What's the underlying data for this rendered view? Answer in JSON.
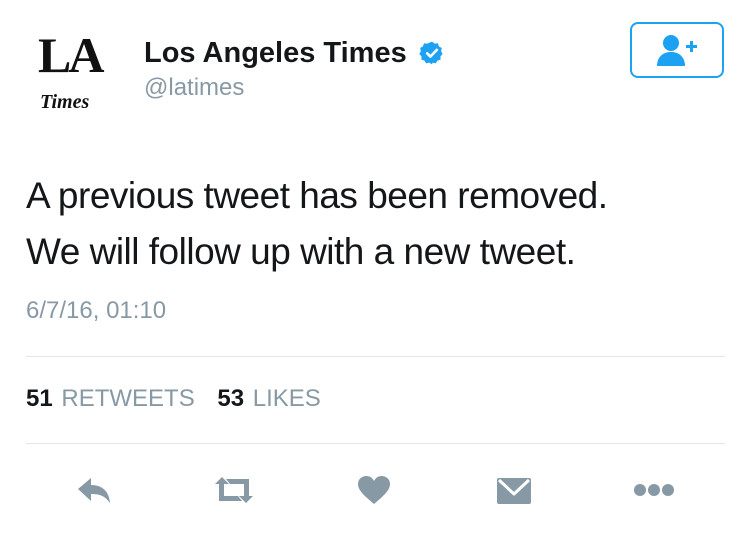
{
  "author": {
    "logo_line1": "LA",
    "logo_line2": "Times",
    "display_name": "Los Angeles Times",
    "handle": "@latimes",
    "verified_icon": "verified-badge-icon"
  },
  "follow_button": {
    "icon": "add-user-icon"
  },
  "tweet": {
    "lines": [
      "A previous tweet has been removed.",
      "We will follow up with a new tweet."
    ],
    "timestamp": "6/7/16, 01:10"
  },
  "stats": {
    "retweets_count": "51",
    "retweets_label": "RETWEETS",
    "likes_count": "53",
    "likes_label": "LIKES"
  },
  "actions": [
    "reply-icon",
    "retweet-icon",
    "like-icon",
    "direct-message-icon",
    "more-icon"
  ],
  "colors": {
    "accent": "#1da1f2",
    "secondary_text": "#8899a6",
    "icon_gray": "#8899a6",
    "divider": "#e1e8ed"
  }
}
